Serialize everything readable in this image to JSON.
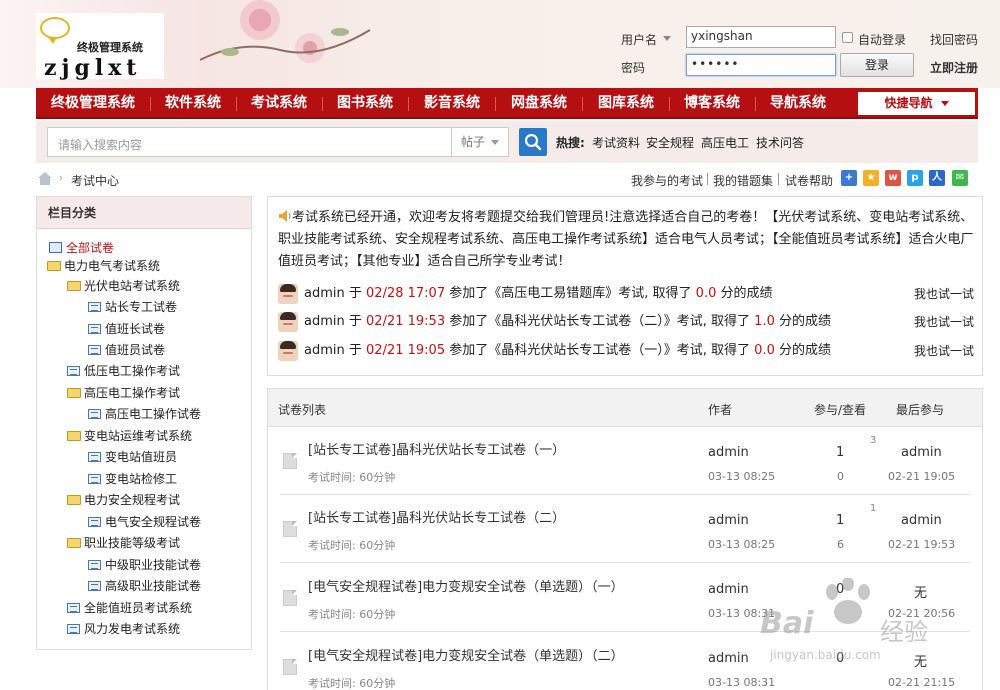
{
  "header": {
    "logo_cn": "终极管理系统",
    "logo_en": "zjglxt",
    "username_label": "用户名",
    "username_value": "yxingshan",
    "password_label": "密码",
    "password_value": "••••••",
    "autologin_label": "自动登录",
    "forgot_label": "找回密码",
    "login_button": "登录",
    "register_label": "立即注册"
  },
  "nav": {
    "items": [
      "终极管理系统",
      "软件系统",
      "考试系统",
      "图书系统",
      "影音系统",
      "网盘系统",
      "图库系统",
      "博客系统",
      "导航系统"
    ],
    "quick": "快捷导航"
  },
  "search": {
    "placeholder": "请输入搜索内容",
    "scope": "帖子",
    "hot_label": "热搜:",
    "hot": [
      "考试资料",
      "安全规程",
      "高压电工",
      "技术问答"
    ]
  },
  "breadcrumb": {
    "current": "考试中心"
  },
  "toolbar": {
    "links": [
      "我参与的考试",
      "我的错题集",
      "试卷帮助"
    ]
  },
  "sidebar": {
    "title": "栏目分类",
    "items": [
      "全部试卷",
      "电力电气考试系统",
      "光伏电站考试系统",
      "站长专工试卷",
      "值班长试卷",
      "值班员试卷",
      "低压电工操作考试",
      "高压电工操作考试",
      "高压电工操作试卷",
      "变电站运维考试系统",
      "变电站值班员",
      "变电站检修工",
      "电力安全规程考试",
      "电气安全规程试卷",
      "职业技能等级考试",
      "中级职业技能试卷",
      "高级职业技能试卷",
      "全能值班员考试系统",
      "风力发电考试系统"
    ]
  },
  "notice": {
    "text": "考试系统已经开通，欢迎考友将考题提交给我们管理员!注意选择适合自己的考卷！【光伏考试系统、变电站考试系统、职业技能考试系统、安全规程考试系统、高压电工操作考试系统】适合电气人员考试；【全能值班员考试系统】适合火电厂值班员考试；【其他专业】适合自己所学专业考试！"
  },
  "activity": [
    {
      "user": "admin",
      "at": "于",
      "time": "02/28 17:07",
      "joined": "参加了",
      "paper": "《高压电工易错题库》",
      "mid": "考试, 取得了",
      "score": "0.0",
      "suffix": "分的成绩",
      "try": "我也试一试"
    },
    {
      "user": "admin",
      "at": "于",
      "time": "02/21 19:53",
      "joined": "参加了",
      "paper": "《晶科光伏站长专工试卷（二）》",
      "mid": "考试, 取得了",
      "score": "1.0",
      "suffix": "分的成绩",
      "try": "我也试一试"
    },
    {
      "user": "admin",
      "at": "于",
      "time": "02/21 19:05",
      "joined": "参加了",
      "paper": "《晶科光伏站长专工试卷（一）》",
      "mid": "考试, 取得了",
      "score": "0.0",
      "suffix": "分的成绩",
      "try": "我也试一试"
    }
  ],
  "list": {
    "headers": {
      "title": "试卷列表",
      "author": "作者",
      "stats": "参与/查看",
      "last": "最后参与"
    },
    "rows": [
      {
        "title": "[站长专工试卷]晶科光伏站长专工试卷（一）",
        "time": "考试时间: 60分钟",
        "author": "admin",
        "date": "03-13 08:25",
        "join": "1",
        "view": "0",
        "sup": "3",
        "last_user": "admin",
        "last_time": "02-21 19:05"
      },
      {
        "title": "[站长专工试卷]晶科光伏站长专工试卷（二）",
        "time": "考试时间: 60分钟",
        "author": "admin",
        "date": "03-13 08:25",
        "join": "1",
        "view": "6",
        "sup": "1",
        "last_user": "admin",
        "last_time": "02-21 19:53"
      },
      {
        "title": "[电气安全规程试卷]电力变规安全试卷（单选题）（一）",
        "time": "考试时间: 60分钟",
        "author": "admin",
        "date": "03-13 08:31",
        "join": "0",
        "view": "",
        "sup": "",
        "last_user": "无",
        "last_time": "02-21 20:56"
      },
      {
        "title": "[电气安全规程试卷]电力变规安全试卷（单选题）（二）",
        "time": "考试时间: 60分钟",
        "author": "admin",
        "date": "03-13 08:31",
        "join": "0",
        "view": "",
        "sup": "",
        "last_user": "无",
        "last_time": "02-21 21:15"
      }
    ]
  },
  "watermark": {
    "brand": "Bai",
    "brand_cn": "经验",
    "url": "jingyan.baidu.com"
  },
  "colors": {
    "nav_red": "#b60f12",
    "accent_blue": "#2a79c8",
    "highlight_red": "#c91010"
  }
}
